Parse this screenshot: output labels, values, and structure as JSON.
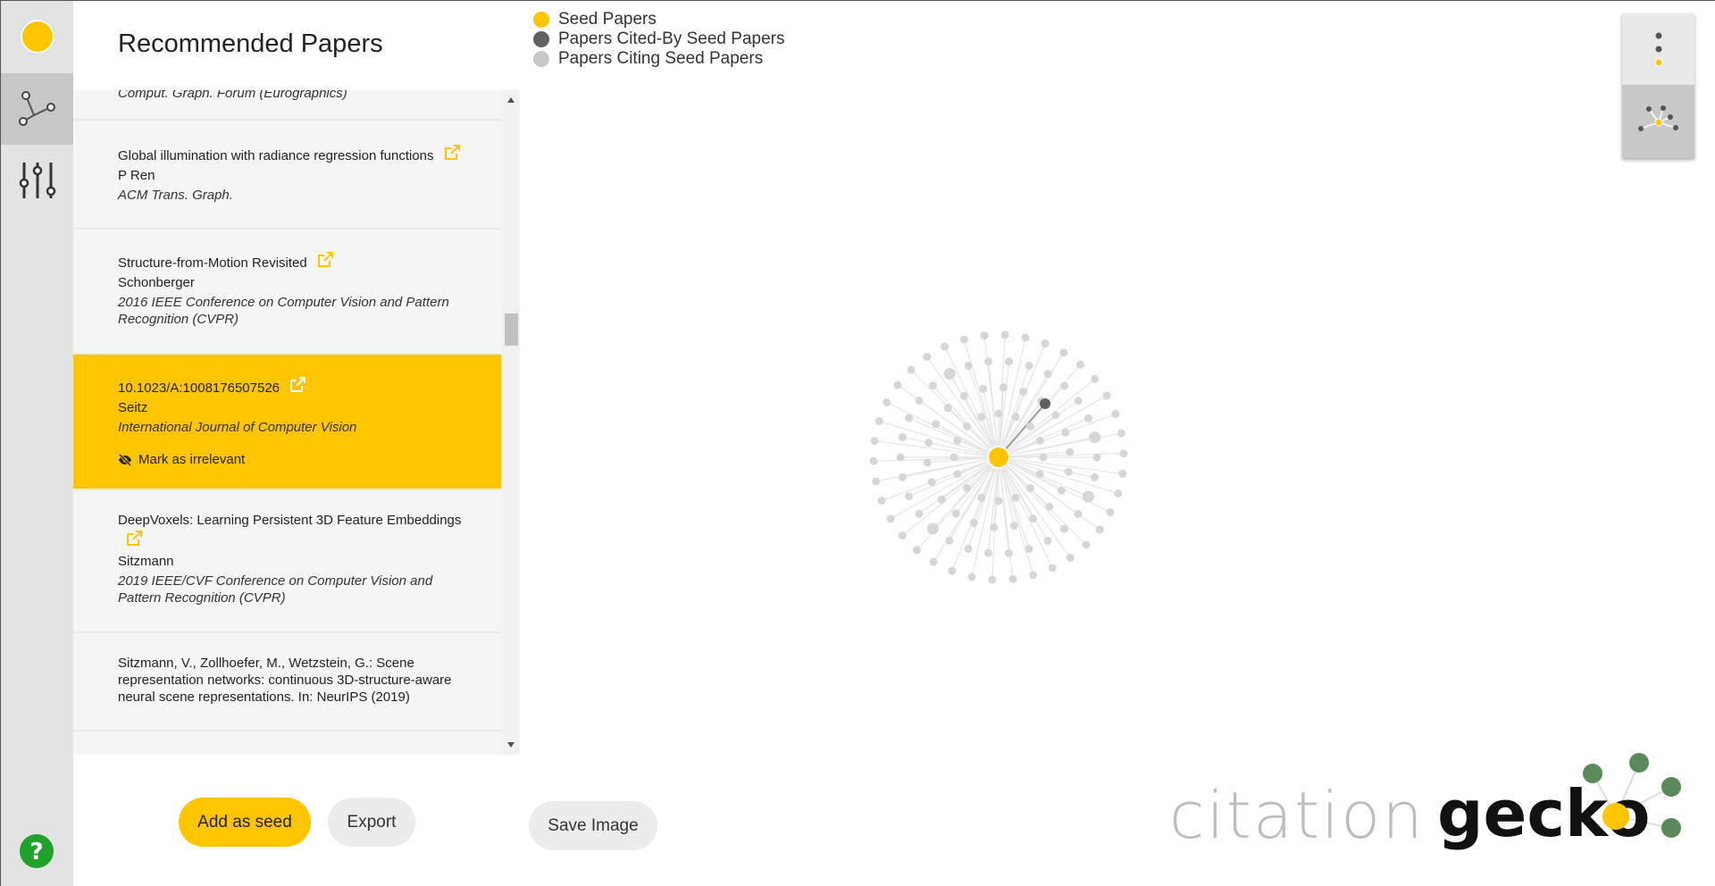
{
  "panel": {
    "title": "Recommended Papers"
  },
  "papers": [
    {
      "title": "",
      "author": "",
      "venue": "Comput. Graph. Forum (Eurographics)"
    },
    {
      "title": "Global illumination with radiance regression functions",
      "author": "P Ren",
      "venue": "ACM Trans. Graph."
    },
    {
      "title": "Structure-from-Motion Revisited",
      "author": "Schonberger",
      "venue": "2016 IEEE Conference on Computer Vision and Pattern Recognition (CVPR)"
    },
    {
      "title": "10.1023/A:1008176507526",
      "author": "Seitz",
      "venue": "International Journal of Computer Vision",
      "action": "Mark as irrelevant"
    },
    {
      "title": "DeepVoxels: Learning Persistent 3D Feature Embeddings",
      "author": "Sitzmann",
      "venue": "2019 IEEE/CVF Conference on Computer Vision and Pattern Recognition (CVPR)"
    },
    {
      "title": "Sitzmann, V., Zollhoefer, M., Wetzstein, G.: Scene representation networks: continuous 3D-structure-aware neural scene representations. In: NeurIPS (2019)",
      "author": "",
      "venue": ""
    }
  ],
  "buttons": {
    "add_seed": "Add as seed",
    "export": "Export",
    "save_image": "Save Image"
  },
  "legend": [
    {
      "label": "Seed Papers",
      "color": "#ffc500"
    },
    {
      "label": "Papers Cited-By Seed Papers",
      "color": "#606060"
    },
    {
      "label": "Papers Citing Seed Papers",
      "color": "#c8c8c8"
    }
  ],
  "logo": {
    "word1": "citation",
    "word2": "geck",
    "word3": "o"
  },
  "colors": {
    "accent": "#ffc500",
    "rail": "#e3e3e3",
    "gecko_green": "#5a8a5a",
    "help_green": "#1fa12c"
  },
  "icons": {
    "rail": [
      "seed-dot-icon",
      "network-icon",
      "sliders-icon",
      "help-icon"
    ],
    "view": [
      "list-view-icon",
      "network-view-icon"
    ],
    "external": "external-link-icon",
    "hidden": "eye-slash-icon"
  },
  "graph": {
    "seed_count": 1,
    "cited_by_count": 1,
    "citing_count": 110,
    "selected_index": 0
  }
}
